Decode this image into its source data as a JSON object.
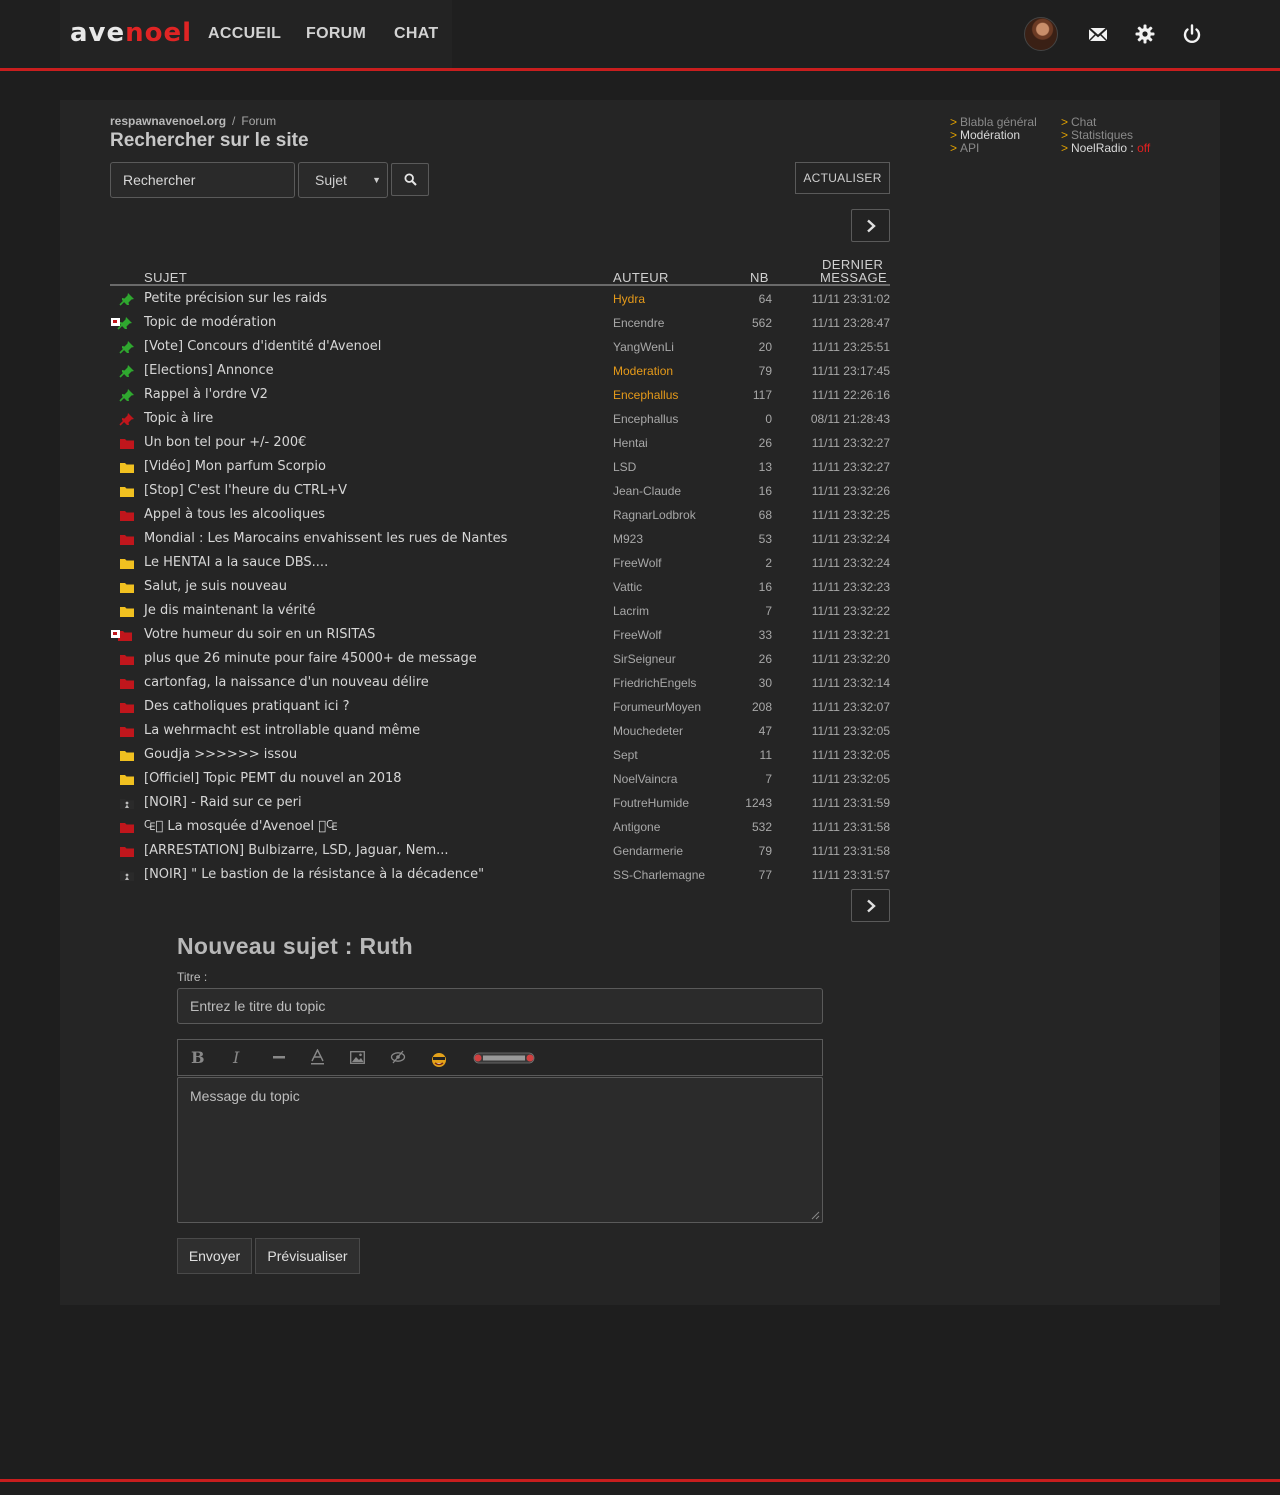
{
  "brand": {
    "part1": "ave",
    "part2": "noel"
  },
  "nav": {
    "home": "ACCUEIL",
    "forum": "FORUM",
    "chat": "CHAT"
  },
  "breadcrumb": {
    "site": "respawnavenoel.org",
    "separator": "/",
    "section": "Forum"
  },
  "page_title": "Rechercher sur le site",
  "search": {
    "placeholder": "Rechercher",
    "scope_selected": "Sujet",
    "refresh_label": "ACTUALISER"
  },
  "side_links": {
    "left": [
      {
        "label": "Blabla général",
        "active": false
      },
      {
        "label": "Modération",
        "active": true
      },
      {
        "label": "API",
        "active": false
      }
    ],
    "right": [
      {
        "label": "Chat",
        "active": false
      },
      {
        "label": "Statistiques",
        "active": false
      },
      {
        "label": "NoelRadio :",
        "active": true,
        "status": "off"
      }
    ]
  },
  "table": {
    "headers": {
      "subject": "SUJET",
      "author": "AUTEUR",
      "count": "NB",
      "last_1": "DERNIER",
      "last_2": "MESSAGE"
    },
    "rows": [
      {
        "icon": "pin-green",
        "subject": "Petite précision sur les raids",
        "author": "Hydra",
        "author_role": "mod",
        "count": "64",
        "last": "11/11 23:31:02"
      },
      {
        "icon": "pin-green-locked",
        "subject": "Topic de modération",
        "author": "Encendre",
        "author_role": "user",
        "count": "562",
        "last": "11/11 23:28:47"
      },
      {
        "icon": "pin-green",
        "subject": "[Vote] Concours d'identité d'Avenoel",
        "author": "YangWenLi",
        "author_role": "user",
        "count": "20",
        "last": "11/11 23:25:51"
      },
      {
        "icon": "pin-green",
        "subject": "[Elections] Annonce",
        "author": "Moderation",
        "author_role": "mod",
        "count": "79",
        "last": "11/11 23:17:45"
      },
      {
        "icon": "pin-green",
        "subject": "Rappel à l'ordre V2",
        "author": "Encephallus",
        "author_role": "mod",
        "count": "117",
        "last": "11/11 22:26:16"
      },
      {
        "icon": "pin-red",
        "subject": "Topic à lire",
        "author": "Encephallus",
        "author_role": "user",
        "count": "0",
        "last": "08/11 21:28:43"
      },
      {
        "icon": "folder-red",
        "subject": "Un bon tel pour +/- 200€",
        "author": "Hentai",
        "author_role": "user",
        "count": "26",
        "last": "11/11 23:32:27"
      },
      {
        "icon": "folder-yellow",
        "subject": "[Vidéo] Mon parfum Scorpio",
        "author": "LSD",
        "author_role": "user",
        "count": "13",
        "last": "11/11 23:32:27"
      },
      {
        "icon": "folder-yellow",
        "subject": "[Stop] C'est l'heure du CTRL+V",
        "author": "Jean-Claude",
        "author_role": "user",
        "count": "16",
        "last": "11/11 23:32:26"
      },
      {
        "icon": "folder-red",
        "subject": "Appel à tous les alcooliques",
        "author": "RagnarLodbrok",
        "author_role": "user",
        "count": "68",
        "last": "11/11 23:32:25"
      },
      {
        "icon": "folder-red",
        "subject": "Mondial : Les Marocains envahissent les rues de Nantes",
        "author": "M923",
        "author_role": "user",
        "count": "53",
        "last": "11/11 23:32:24"
      },
      {
        "icon": "folder-yellow",
        "subject": "Le HENTAI a la sauce DBS....",
        "author": "FreeWolf",
        "author_role": "user",
        "count": "2",
        "last": "11/11 23:32:24"
      },
      {
        "icon": "folder-yellow",
        "subject": "Salut, je suis nouveau",
        "author": "Vattic",
        "author_role": "user",
        "count": "16",
        "last": "11/11 23:32:23"
      },
      {
        "icon": "folder-yellow",
        "subject": "Je dis maintenant la vérité",
        "author": "Lacrim",
        "author_role": "user",
        "count": "7",
        "last": "11/11 23:32:22"
      },
      {
        "icon": "folder-red-locked",
        "subject": "Votre humeur du soir en un RISITAS",
        "author": "FreeWolf",
        "author_role": "user",
        "count": "33",
        "last": "11/11 23:32:21"
      },
      {
        "icon": "folder-red",
        "subject": "plus que 26 minute pour faire 45000+ de message",
        "author": "SirSeigneur",
        "author_role": "user",
        "count": "26",
        "last": "11/11 23:32:20"
      },
      {
        "icon": "folder-red",
        "subject": "cartonfag, la naissance d'un nouveau délire",
        "author": "FriedrichEngels",
        "author_role": "user",
        "count": "30",
        "last": "11/11 23:32:14"
      },
      {
        "icon": "folder-red",
        "subject": "Des catholiques pratiquant ici ?",
        "author": "ForumeurMoyen",
        "author_role": "user",
        "count": "208",
        "last": "11/11 23:32:07"
      },
      {
        "icon": "folder-red",
        "subject": "La wehrmacht est introllable quand même",
        "author": "Mouchedeter",
        "author_role": "user",
        "count": "47",
        "last": "11/11 23:32:05"
      },
      {
        "icon": "folder-yellow",
        "subject": "Goudja >>>>>> issou",
        "author": "Sept",
        "author_role": "user",
        "count": "11",
        "last": "11/11 23:32:05"
      },
      {
        "icon": "folder-yellow",
        "subject": "[Officiel] Topic PEMT du nouvel an 2018",
        "author": "NoelVaincra",
        "author_role": "user",
        "count": "7",
        "last": "11/11 23:32:05"
      },
      {
        "icon": "folder-dark",
        "subject": "[NOIR] - Raid sur ce peri",
        "author": "FoutreHumide",
        "author_role": "user",
        "count": "1243",
        "last": "11/11 23:31:59"
      },
      {
        "icon": "folder-red",
        "subject": "₠⃝ La mosquée d'Avenoel ⃝₠",
        "author": "Antigone",
        "author_role": "user",
        "count": "532",
        "last": "11/11 23:31:58"
      },
      {
        "icon": "folder-red",
        "subject": "[ARRESTATION] Bulbizarre, LSD, Jaguar, Nem...",
        "author": "Gendarmerie",
        "author_role": "user",
        "count": "79",
        "last": "11/11 23:31:58"
      },
      {
        "icon": "folder-dark",
        "subject": "[NOIR] \" Le bastion de la résistance à la décadence\"",
        "author": "SS-Charlemagne",
        "author_role": "user",
        "count": "77",
        "last": "11/11 23:31:57"
      }
    ]
  },
  "new_topic": {
    "heading": "Nouveau sujet : Ruth",
    "title_label": "Titre :",
    "title_placeholder": "Entrez le titre du topic",
    "message_placeholder": "Message du topic",
    "toolbar": [
      "bold-icon",
      "italic-icon",
      "hr-icon",
      "text-color-icon",
      "image-icon",
      "spoiler-icon",
      "smiley-icon",
      "risibank-icon"
    ],
    "send_label": "Envoyer",
    "preview_label": "Prévisualiser"
  },
  "colors": {
    "accent": "#c81e1e",
    "mod_author": "#e59a1a",
    "pin_green": "#2fa82f",
    "folder_yellow": "#f0c020",
    "folder_red": "#c0161c"
  }
}
